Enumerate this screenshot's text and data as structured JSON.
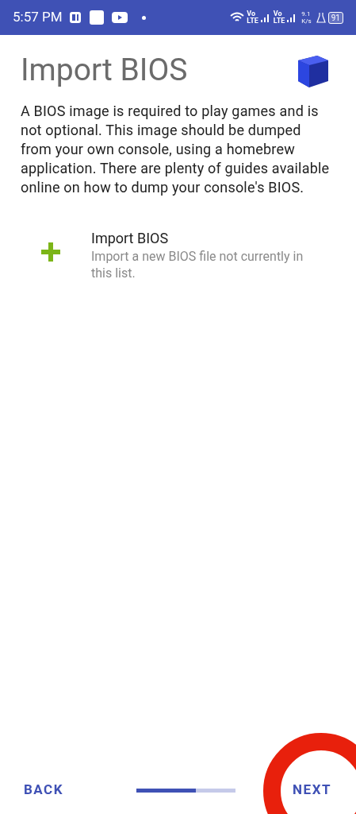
{
  "status_bar": {
    "time": "5:57 PM",
    "network_1": "Vo",
    "network_1_sub": "LTE",
    "network_2": "Vo",
    "network_2_sub": "LTE",
    "speed": "9.1",
    "speed_unit": "K/s",
    "battery": "91"
  },
  "title": "Import BIOS",
  "description": "A BIOS image is required to play games and is not optional. This image should be dumped from your own console, using a homebrew application. There are plenty of guides available online on how to dump your console's BIOS.",
  "items": [
    {
      "title": "Import BIOS",
      "subtitle": "Import a new BIOS file not currently in this list."
    }
  ],
  "footer": {
    "back": "BACK",
    "next": "NEXT",
    "progress": {
      "level": 0.6
    }
  }
}
